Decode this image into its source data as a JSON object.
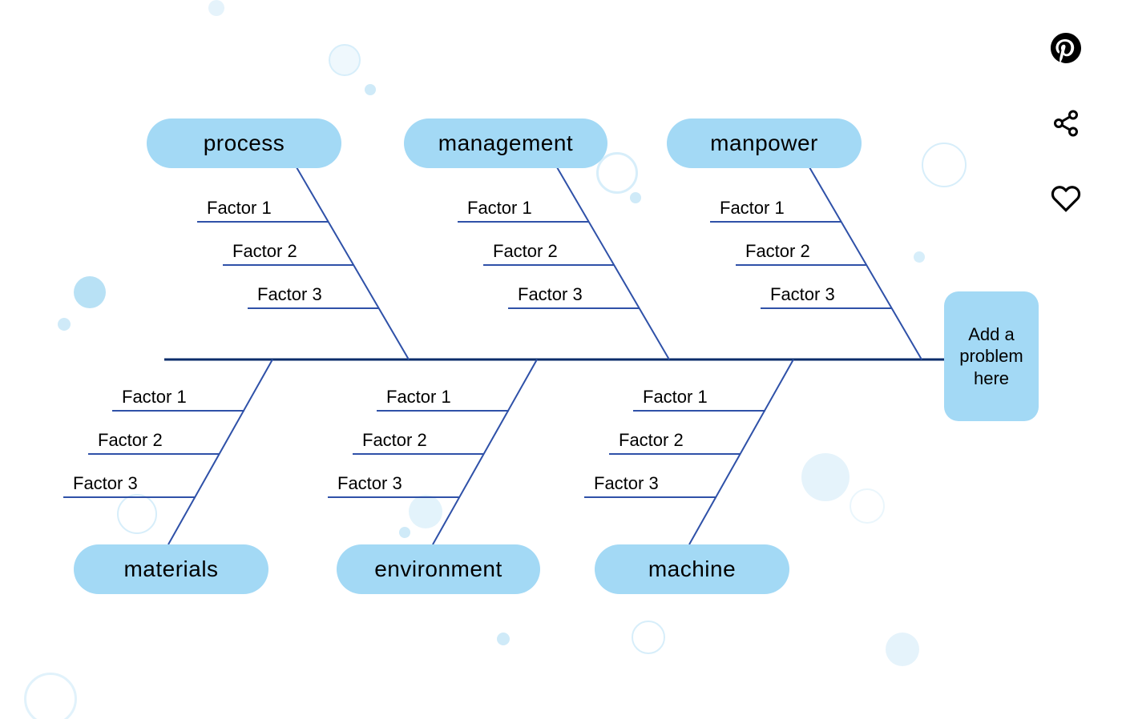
{
  "diagram": {
    "problem_text": "Add a problem here",
    "colors": {
      "pill_bg": "#a3d9f5",
      "spine": "#0b2d6b",
      "rib": "#2f51a8",
      "bubble": "#bfe4f6"
    },
    "categories_top": [
      {
        "label": "process",
        "factors": [
          "Factor 1",
          "Factor 2",
          "Factor 3"
        ]
      },
      {
        "label": "management",
        "factors": [
          "Factor 1",
          "Factor 2",
          "Factor 3"
        ]
      },
      {
        "label": "manpower",
        "factors": [
          "Factor 1",
          "Factor 2",
          "Factor 3"
        ]
      }
    ],
    "categories_bottom": [
      {
        "label": "materials",
        "factors": [
          "Factor 1",
          "Factor 2",
          "Factor 3"
        ]
      },
      {
        "label": "environment",
        "factors": [
          "Factor 1",
          "Factor 2",
          "Factor 3"
        ]
      },
      {
        "label": "machine",
        "factors": [
          "Factor 1",
          "Factor 2",
          "Factor 3"
        ]
      }
    ]
  },
  "actions": {
    "pinterest_title": "Pinterest",
    "share_title": "Share",
    "like_title": "Like"
  }
}
